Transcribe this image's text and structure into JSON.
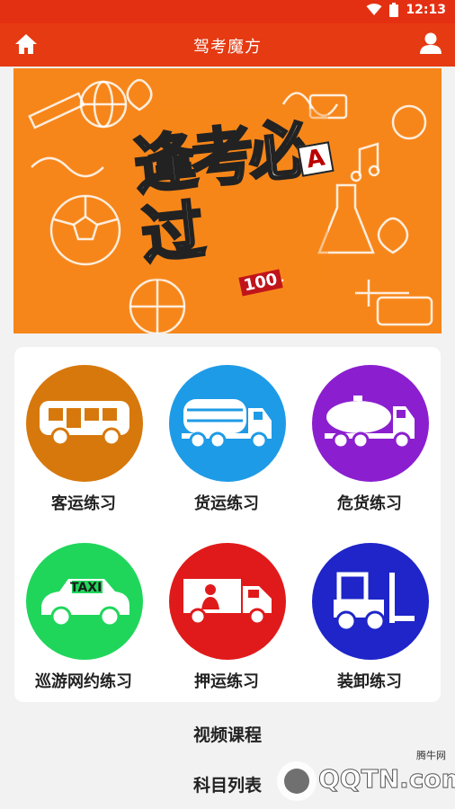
{
  "status_bar": {
    "time": "12:13",
    "icons": [
      "wifi-icon",
      "battery-icon"
    ]
  },
  "app_bar": {
    "title": "驾考魔方",
    "left_icon": "home-icon",
    "right_icon": "user-icon"
  },
  "banner": {
    "headline": "逢考必过",
    "badge_letter": "A",
    "badge_score": "100"
  },
  "practice_tiles": [
    {
      "label": "客运练习",
      "icon": "bus-icon",
      "color": "#d7780c"
    },
    {
      "label": "货运练习",
      "icon": "tanker-truck-icon",
      "color": "#1e9be6"
    },
    {
      "label": "危货练习",
      "icon": "hazmat-tanker-icon",
      "color": "#8b1fcf"
    },
    {
      "label": "巡游网约练习",
      "icon": "taxi-icon",
      "color": "#1fd65b"
    },
    {
      "label": "押运练习",
      "icon": "escort-truck-icon",
      "color": "#e01a1a"
    },
    {
      "label": "装卸练习",
      "icon": "forklift-icon",
      "color": "#1f25c8"
    }
  ],
  "menu": [
    {
      "label": "视频课程"
    },
    {
      "label": "科目列表"
    }
  ],
  "watermark": {
    "text": "QQTN.com",
    "site": "腾牛网"
  },
  "colors": {
    "accent": "#e53a12",
    "banner": "#f7861a"
  }
}
